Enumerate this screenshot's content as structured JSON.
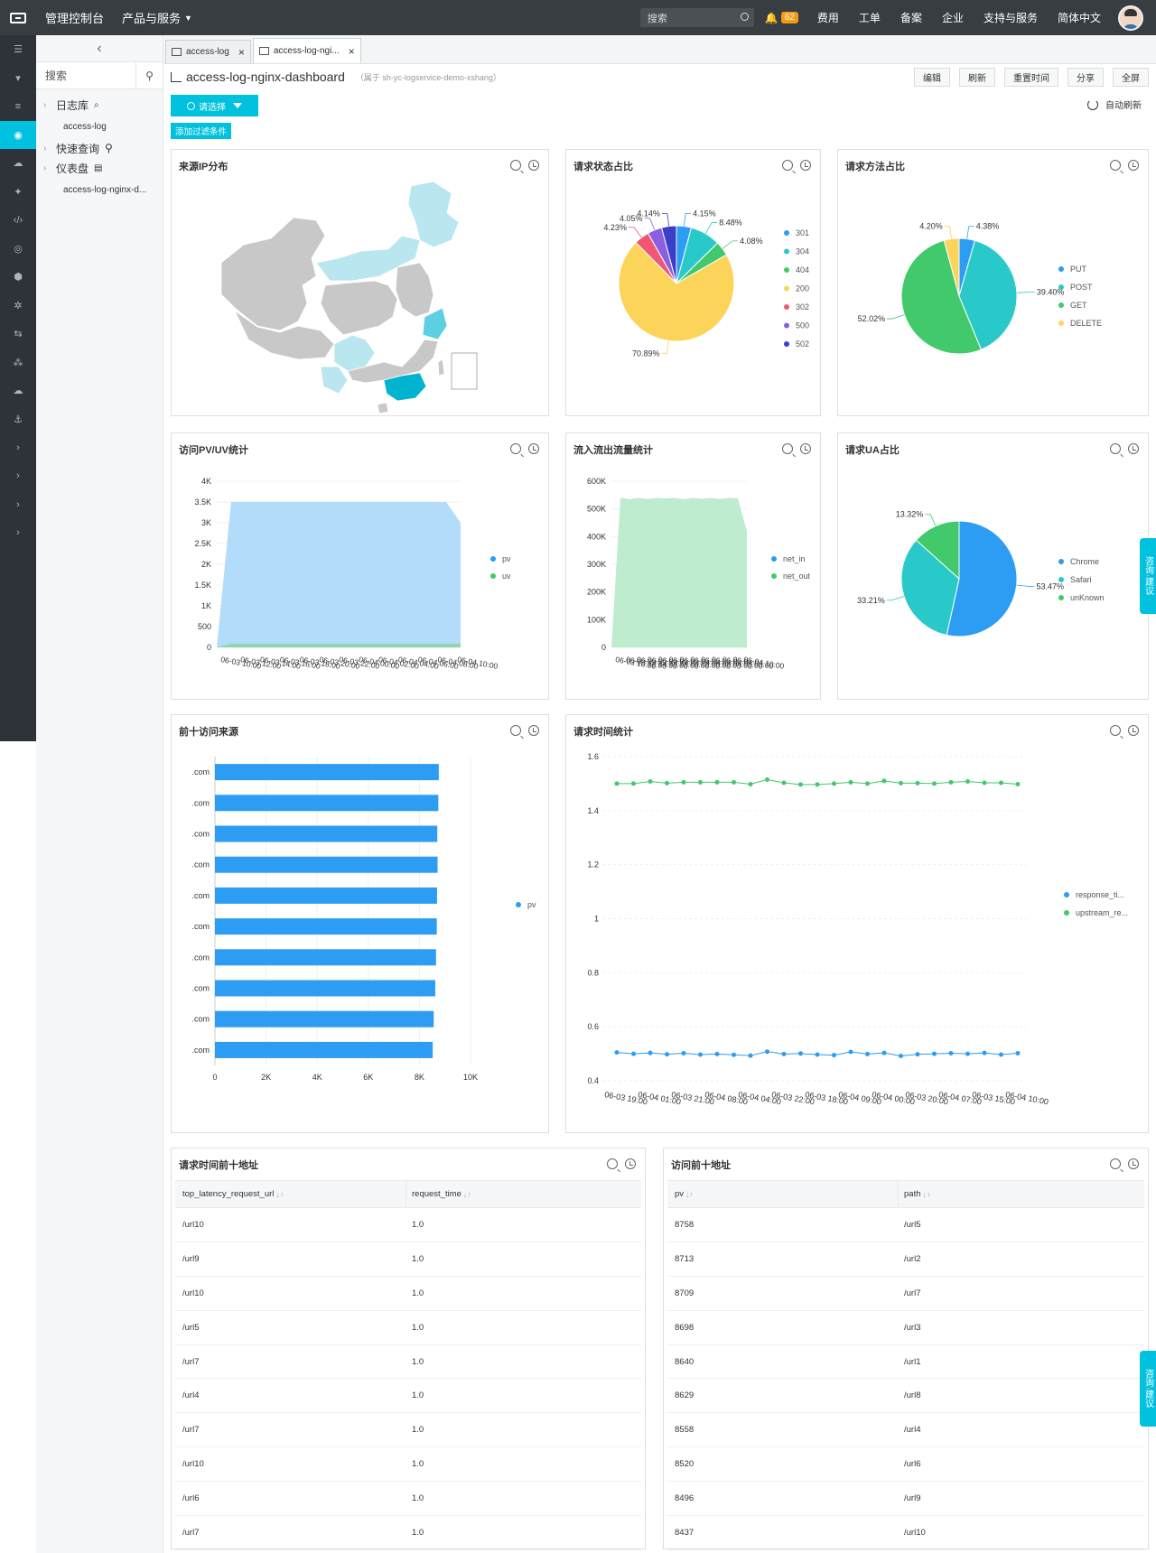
{
  "topbar": {
    "console": "管理控制台",
    "products": "产品与服务",
    "search_placeholder": "搜索",
    "notif_count": "62",
    "links": [
      "费用",
      "工单",
      "备案",
      "企业",
      "支持与服务",
      "简体中文"
    ]
  },
  "sidebar": {
    "search_placeholder": "搜索",
    "logstore_label": "日志库",
    "logstore_item": "access-log",
    "quickquery_label": "快速查询",
    "dashboard_label": "仪表盘",
    "dashboard_item": "access-log-nginx-d..."
  },
  "tabs": [
    {
      "label": "access-log"
    },
    {
      "label": "access-log-ngi..."
    }
  ],
  "page": {
    "title": "access-log-nginx-dashboard",
    "subtitle": "（属于 sh-yc-logservice-demo-xshang）",
    "buttons": [
      "编辑",
      "刷新",
      "重置时间",
      "分享",
      "全屏"
    ],
    "select_label": "请选择",
    "auto_refresh": "自动刷新",
    "add_filter": "添加过滤条件"
  },
  "consult_label": "咨询·建议",
  "colors": {
    "accent": "#00c1de",
    "blue": "#2d9cf3",
    "teal": "#2ac9c9",
    "green": "#42c96c",
    "yellow": "#fdd45a",
    "red": "#ef5775",
    "purple": "#8a5fe0",
    "navy": "#3b3fc8"
  },
  "panels": {
    "map_title": "来源IP分布",
    "status_title": "请求状态占比",
    "method_title": "请求方法占比",
    "pvuv_title": "访问PV/UV统计",
    "traffic_title": "流入流出流量统计",
    "ua_title": "请求UA占比",
    "top10_title": "前十访问来源",
    "reqtime_title": "请求时间统计",
    "latency_table_title": "请求时间前十地址",
    "pv_table_title": "访问前十地址"
  },
  "chart_data": [
    {
      "type": "pie",
      "title": "请求状态占比",
      "labels": [
        "301",
        "304",
        "404",
        "200",
        "302",
        "500",
        "502"
      ],
      "values": [
        4.15,
        8.48,
        4.08,
        70.89,
        4.23,
        4.05,
        4.14
      ],
      "value_labels": [
        "4.15%",
        "8.48%",
        "4.08%",
        "70.89%",
        "4.23%",
        "4.05%",
        "4.14%"
      ],
      "colors": [
        "#2d9cf3",
        "#2ac9c9",
        "#42c96c",
        "#fdd45a",
        "#ef5775",
        "#8a5fe0",
        "#3b3fc8"
      ]
    },
    {
      "type": "pie",
      "title": "请求方法占比",
      "labels": [
        "PUT",
        "POST",
        "GET",
        "DELETE"
      ],
      "values": [
        4.38,
        39.4,
        52.02,
        4.2
      ],
      "value_labels": [
        "4.38%",
        "39.40%",
        "52.02%",
        "4.20%"
      ],
      "colors": [
        "#2d9cf3",
        "#2ac9c9",
        "#42c96c",
        "#fdd45a"
      ]
    },
    {
      "type": "pie",
      "title": "请求UA占比",
      "labels": [
        "Chrome",
        "Safari",
        "unKnown"
      ],
      "values": [
        53.47,
        33.21,
        13.32
      ],
      "value_labels": [
        "53.47%",
        "33.21%",
        "13.32%"
      ],
      "colors": [
        "#2d9cf3",
        "#2ac9c9",
        "#42c96c"
      ]
    },
    {
      "type": "area",
      "title": "访问PV/UV统计",
      "yticks": [
        "0",
        "500",
        "1K",
        "1.5K",
        "2K",
        "2.5K",
        "3K",
        "3.5K",
        "4K"
      ],
      "ylim": [
        0,
        4000
      ],
      "series": [
        {
          "name": "pv",
          "values": [
            0,
            3500,
            3500,
            3500,
            3500,
            3500,
            3500,
            3500,
            3500,
            3500,
            3500,
            3500,
            3500,
            3500,
            3500,
            3500,
            3500,
            3000
          ],
          "color": "#b3dcfb"
        },
        {
          "name": "uv",
          "values": [
            0,
            90,
            90,
            90,
            90,
            90,
            90,
            90,
            90,
            90,
            90,
            90,
            90,
            90,
            90,
            90,
            90,
            90
          ],
          "color": "#8fd6b2"
        }
      ],
      "xticks": [
        "06-03 10:00",
        "06-03 12:00",
        "06-03 14:00",
        "06-03 16:00",
        "06-03 18:00",
        "06-03 20:00",
        "06-03 22:00",
        "06-04 00:00",
        "06-04 02:00",
        "06-04 04:00",
        "06-04 06:00",
        "06-04 08:00",
        "06-04 10:00"
      ]
    },
    {
      "type": "area",
      "title": "流入流出流量统计",
      "yticks": [
        "0",
        "100K",
        "200K",
        "300K",
        "400K",
        "500K",
        "600K"
      ],
      "ylim": [
        0,
        600000
      ],
      "series": [
        {
          "name": "net_in",
          "values": [
            0,
            0,
            0,
            0,
            0,
            0,
            0,
            0,
            0,
            0,
            0,
            0,
            0,
            0,
            0,
            0
          ],
          "color": "#2d9cf3"
        },
        {
          "name": "net_out",
          "values": [
            0,
            540000,
            535000,
            540000,
            536000,
            540000,
            538000,
            540000,
            535000,
            540000,
            537000,
            540000,
            536000,
            540000,
            538000,
            420000
          ],
          "color": "#bfebcf"
        }
      ],
      "xticks": [
        "06-03 10:00",
        "06-03 12:00",
        "06-03 14:00",
        "06-03 16:00",
        "06-03 18:00",
        "06-03 20:00",
        "06-03 22:00",
        "06-04 00:00",
        "06-04 02:00",
        "06-04 04:00",
        "06-04 06:00",
        "06-04 08:00",
        "06-04 10:00"
      ]
    },
    {
      "type": "bar",
      "title": "前十访问来源",
      "orientation": "horizontal",
      "categories": [
        ".com",
        ".com",
        ".com",
        ".com",
        ".com",
        ".com",
        ".com",
        ".com",
        ".com",
        ".com"
      ],
      "series": [
        {
          "name": "pv",
          "values": [
            8758,
            8740,
            8700,
            8710,
            8690,
            8680,
            8650,
            8620,
            8560,
            8520
          ]
        }
      ],
      "xticks": [
        "0",
        "2K",
        "4K",
        "6K",
        "8K",
        "10K"
      ],
      "xlim": [
        0,
        10000
      ]
    },
    {
      "type": "line",
      "title": "请求时间统计",
      "yticks": [
        "0.4",
        "0.6",
        "0.8",
        "1",
        "1.2",
        "1.4",
        "1.6"
      ],
      "ylim": [
        0.4,
        1.6
      ],
      "series": [
        {
          "name": "response_ti...",
          "color": "#2d9cf3",
          "values": [
            0.505,
            0.5,
            0.503,
            0.498,
            0.502,
            0.497,
            0.499,
            0.496,
            0.493,
            0.508,
            0.499,
            0.501,
            0.497,
            0.495,
            0.507,
            0.499,
            0.503,
            0.492,
            0.498,
            0.5,
            0.502,
            0.5,
            0.503,
            0.497,
            0.502
          ]
        },
        {
          "name": "upstream_re...",
          "color": "#42c96c",
          "values": [
            1.5,
            1.5,
            1.508,
            1.502,
            1.505,
            1.505,
            1.505,
            1.505,
            1.498,
            1.515,
            1.503,
            1.497,
            1.497,
            1.5,
            1.505,
            1.5,
            1.51,
            1.502,
            1.502,
            1.5,
            1.505,
            1.508,
            1.503,
            1.503,
            1.498
          ]
        }
      ],
      "xticks": [
        "06-03 19:00",
        "06-04 01:00",
        "06-03 21:00",
        "06-04 08:00",
        "06-04 04:00",
        "06-03 22:00",
        "06-03 18:00",
        "06-04 09:00",
        "06-04 00:00",
        "06-03 20:00",
        "06-04 07:00",
        "06-03 15:00",
        "06-04 10:00"
      ]
    }
  ],
  "latency_table": {
    "headers": [
      "top_latency_request_url",
      "request_time"
    ],
    "rows": [
      [
        "/url10",
        "1.0"
      ],
      [
        "/url9",
        "1.0"
      ],
      [
        "/url10",
        "1.0"
      ],
      [
        "/url5",
        "1.0"
      ],
      [
        "/url7",
        "1.0"
      ],
      [
        "/url4",
        "1.0"
      ],
      [
        "/url7",
        "1.0"
      ],
      [
        "/url10",
        "1.0"
      ],
      [
        "/url6",
        "1.0"
      ],
      [
        "/url7",
        "1.0"
      ]
    ]
  },
  "pv_table": {
    "headers": [
      "pv",
      "path"
    ],
    "rows": [
      [
        "8758",
        "/url5"
      ],
      [
        "8713",
        "/url2"
      ],
      [
        "8709",
        "/url7"
      ],
      [
        "8698",
        "/url3"
      ],
      [
        "8640",
        "/url1"
      ],
      [
        "8629",
        "/url8"
      ],
      [
        "8558",
        "/url4"
      ],
      [
        "8520",
        "/url6"
      ],
      [
        "8496",
        "/url9"
      ],
      [
        "8437",
        "/url10"
      ]
    ]
  }
}
